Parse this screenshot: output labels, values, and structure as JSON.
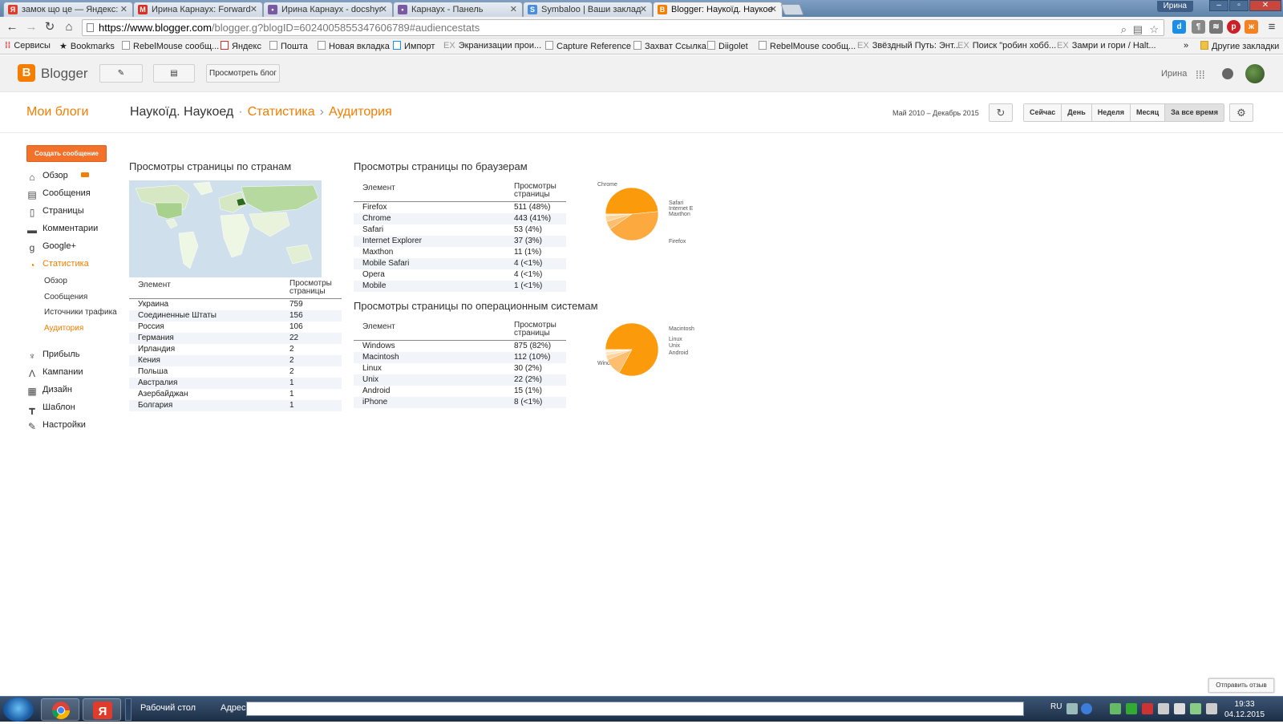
{
  "browser": {
    "tabs": [
      {
        "title": "замок що це — Яндекс:",
        "icon": "yandex-icon",
        "color": "#e03c2c",
        "glyph": "Я"
      },
      {
        "title": "Ирина Карнаух: Forward",
        "icon": "gmail-icon",
        "color": "#d93025",
        "glyph": "M"
      },
      {
        "title": "Ирина Карнаух - docshyr",
        "icon": "site-icon",
        "color": "#7a5aa3",
        "glyph": "•"
      },
      {
        "title": "Карнаух - Панель",
        "icon": "site-icon",
        "color": "#7a5aa3",
        "glyph": "•"
      },
      {
        "title": "Symbaloo | Ваши заклад",
        "icon": "symbaloo-icon",
        "color": "#4a8ed8",
        "glyph": "S"
      },
      {
        "title": "Blogger: Наукоїд. Наукое",
        "icon": "blogger-icon",
        "color": "#f57d00",
        "glyph": "B"
      }
    ],
    "user_badge": "Ирина",
    "url_host": "https://www.blogger.com",
    "url_rest": "/blogger.g?blogID=6024005855347606789#audiencestats",
    "bookmarks": [
      "Сервисы",
      "Bookmarks",
      "RebelMouse сообщ...",
      "Яндекс",
      "Пошта",
      "Новая вкладка",
      "Импорт",
      "Экранизации прои...",
      "Capture Reference",
      "Захват Ссылка",
      "Diigolet",
      "RebelMouse сообщ...",
      "Звёздный Путь: Энт...",
      "Поиск \"робин хобб...",
      "Замри и гори / Halt..."
    ],
    "other_bookmarks": "Другие закладки",
    "more_bookmarks": "»"
  },
  "blogger": {
    "brand": "Blogger",
    "view_blog": "Просмотреть блог",
    "user": "Ирина"
  },
  "title": {
    "my_blogs": "Мои блоги",
    "blog_name": "Наукоїд. Наукоед",
    "dot": "·",
    "stats": "Статистика",
    "arrow": "›",
    "audience": "Аудитория",
    "date_range": "Май 2010 – Декабрь 2015",
    "range_buttons": [
      "Сейчас",
      "День",
      "Неделя",
      "Месяц",
      "За все время"
    ]
  },
  "sidebar": {
    "new_post": "Создать сообщение",
    "items": [
      {
        "label": "Обзор",
        "icon": "home-icon",
        "glyph": "⌂"
      },
      {
        "label": "Сообщения",
        "icon": "posts-icon",
        "glyph": "▤"
      },
      {
        "label": "Страницы",
        "icon": "pages-icon",
        "glyph": "▯"
      },
      {
        "label": "Комментарии",
        "icon": "comment-icon",
        "glyph": "▬"
      },
      {
        "label": "Google+",
        "icon": "googleplus-icon",
        "glyph": "g"
      },
      {
        "label": "Статистика",
        "icon": "stats-icon",
        "glyph": "◔"
      }
    ],
    "subitems": [
      "Обзор",
      "Сообщения",
      "Источники трафика",
      "Аудитория"
    ],
    "items2": [
      {
        "label": "Прибыль",
        "icon": "trophy-icon",
        "glyph": "♆"
      },
      {
        "label": "Кампании",
        "icon": "campaigns-icon",
        "glyph": "Λ"
      },
      {
        "label": "Дизайн",
        "icon": "layout-icon",
        "glyph": "▦"
      },
      {
        "label": "Шаблон",
        "icon": "template-icon",
        "glyph": "┳"
      },
      {
        "label": "Настройки",
        "icon": "wrench-icon",
        "glyph": "✎"
      }
    ]
  },
  "countries": {
    "heading": "Просмотры страницы по странам",
    "col1": "Элемент",
    "col2": "Просмотры страницы",
    "rows": [
      [
        "Украина",
        "759"
      ],
      [
        "Соединенные Штаты",
        "156"
      ],
      [
        "Россия",
        "106"
      ],
      [
        "Германия",
        "22"
      ],
      [
        "Ирландия",
        "2"
      ],
      [
        "Кения",
        "2"
      ],
      [
        "Польша",
        "2"
      ],
      [
        "Австралия",
        "1"
      ],
      [
        "Азербайджан",
        "1"
      ],
      [
        "Болгария",
        "1"
      ]
    ]
  },
  "browsers": {
    "heading": "Просмотры страницы по браузерам",
    "col1": "Элемент",
    "col2": "Просмотры страницы",
    "rows": [
      [
        "Firefox",
        "511 (48%)"
      ],
      [
        "Chrome",
        "443 (41%)"
      ],
      [
        "Safari",
        "53 (4%)"
      ],
      [
        "Internet Explorer",
        "37 (3%)"
      ],
      [
        "Maxthon",
        "11 (1%)"
      ],
      [
        "Mobile Safari",
        "4 (<1%)"
      ],
      [
        "Opera",
        "4 (<1%)"
      ],
      [
        "Mobile",
        "1 (<1%)"
      ]
    ],
    "pie": {
      "values": [
        511,
        443,
        53,
        37,
        11
      ],
      "labels": [
        "Firefox",
        "Chrome",
        "Safari",
        "Internet E",
        "Maxthon"
      ],
      "colors": [
        "#fb9a0b",
        "#fca940",
        "#fdbf6f",
        "#fdd49a",
        "#fee5c2"
      ]
    }
  },
  "os": {
    "heading": "Просмотры страницы по операционным системам",
    "col1": "Элемент",
    "col2": "Просмотры страницы",
    "rows": [
      [
        "Windows",
        "875 (82%)"
      ],
      [
        "Macintosh",
        "112 (10%)"
      ],
      [
        "Linux",
        "30 (2%)"
      ],
      [
        "Unix",
        "22 (2%)"
      ],
      [
        "Android",
        "15 (1%)"
      ],
      [
        "iPhone",
        "8 (<1%)"
      ]
    ],
    "pie": {
      "values": [
        875,
        112,
        30,
        22,
        15
      ],
      "labels": [
        "Windows",
        "Macintosh",
        "Linux",
        "Unix",
        "Android"
      ],
      "colors": [
        "#fb9a0b",
        "#fdbf6f",
        "#fdd49a",
        "#fee5c2",
        "#fff0dc"
      ]
    }
  },
  "feedback": "Отправить отзыв",
  "taskbar": {
    "desktop": "Рабочий стол",
    "address_label": "Адрес",
    "lang": "RU",
    "time": "19:33",
    "date": "04.12.2015"
  }
}
